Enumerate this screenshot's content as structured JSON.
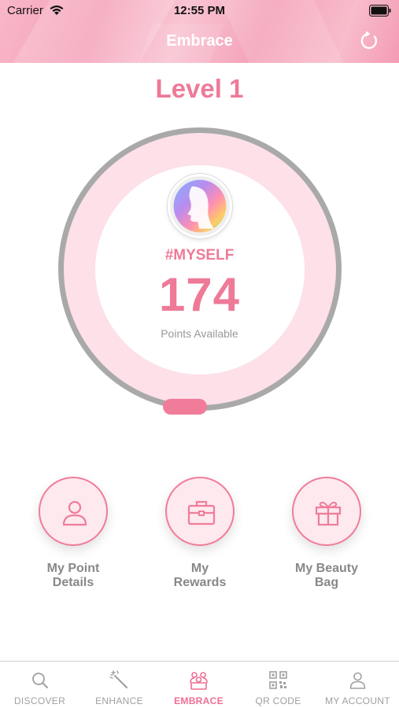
{
  "status_bar": {
    "carrier": "Carrier",
    "time": "12:55 PM"
  },
  "header": {
    "title": "Embrace"
  },
  "level": {
    "title": "Level 1"
  },
  "profile": {
    "tag": "#MYSELF",
    "points": "174",
    "points_label": "Points Available"
  },
  "actions": [
    {
      "label": "My Point\nDetails",
      "icon": "user-icon"
    },
    {
      "label": "My\nRewards",
      "icon": "briefcase-icon"
    },
    {
      "label": "My Beauty\nBag",
      "icon": "gift-icon"
    }
  ],
  "tabs": [
    {
      "label": "DISCOVER",
      "icon": "search-icon",
      "active": false
    },
    {
      "label": "ENHANCE",
      "icon": "magic-wand-icon",
      "active": false
    },
    {
      "label": "EMBRACE",
      "icon": "people-group-icon",
      "active": true
    },
    {
      "label": "QR CODE",
      "icon": "qr-code-icon",
      "active": false
    },
    {
      "label": "MY ACCOUNT",
      "icon": "user-icon",
      "active": false
    }
  ],
  "colors": {
    "accent": "#ee7a98",
    "ring": "#fde0e8",
    "ring_border": "#a9a9a9",
    "muted": "#9a9a9a"
  }
}
